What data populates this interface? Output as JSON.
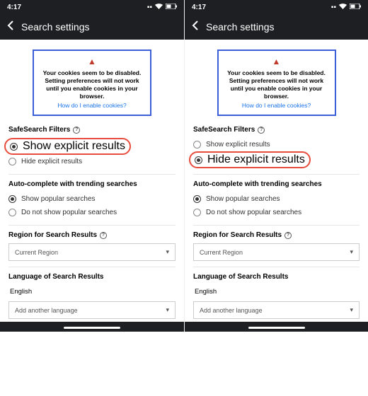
{
  "status": {
    "time": "4:17"
  },
  "header": {
    "title": "Search settings"
  },
  "notice": {
    "line1": "Your cookies seem to be disabled.",
    "line2": "Setting preferences will not work until you enable cookies in your browser.",
    "link": "How do I enable cookies?"
  },
  "safesearch": {
    "title": "SafeSearch Filters",
    "show": "Show explicit results",
    "hide": "Hide explicit results"
  },
  "autocomplete": {
    "title": "Auto-complete with trending searches",
    "show": "Show popular searches",
    "hide": "Do not show popular searches"
  },
  "region": {
    "title": "Region for Search Results",
    "value": "Current Region"
  },
  "language": {
    "title": "Language of Search Results",
    "value": "English",
    "add": "Add another language"
  }
}
